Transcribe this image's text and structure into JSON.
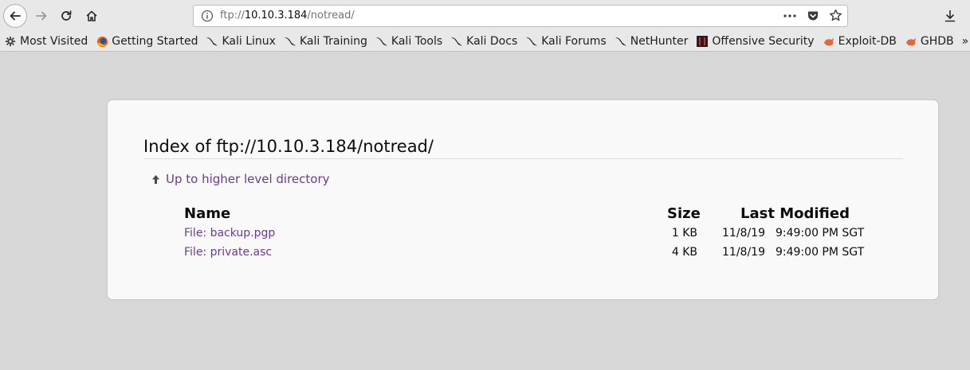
{
  "browser": {
    "url_prefix": "ftp://",
    "url_host": "10.10.3.184",
    "url_path": "/notread/"
  },
  "bookmarks": [
    {
      "label": "Most Visited",
      "icon": "gear-icon"
    },
    {
      "label": "Getting Started",
      "icon": "firefox-icon"
    },
    {
      "label": "Kali Linux",
      "icon": "kali-dragon-icon"
    },
    {
      "label": "Kali Training",
      "icon": "kali-dragon-icon"
    },
    {
      "label": "Kali Tools",
      "icon": "kali-dragon-icon"
    },
    {
      "label": "Kali Docs",
      "icon": "kali-dragon-icon"
    },
    {
      "label": "Kali Forums",
      "icon": "kali-dragon-icon"
    },
    {
      "label": "NetHunter",
      "icon": "kali-dragon-icon"
    },
    {
      "label": "Offensive Security",
      "icon": "offsec-icon"
    },
    {
      "label": "Exploit-DB",
      "icon": "exploitdb-icon"
    },
    {
      "label": "GHDB",
      "icon": "exploitdb-icon"
    }
  ],
  "listing": {
    "title": "Index of ftp://10.10.3.184/notread/",
    "up_link": "Up to higher level directory",
    "headers": {
      "name": "Name",
      "size": "Size",
      "modified": "Last Modified"
    },
    "files": [
      {
        "name": "File: backup.pgp",
        "size": "1 KB",
        "date": "11/8/19",
        "time": "9:49:00 PM SGT"
      },
      {
        "name": "File: private.asc",
        "size": "4 KB",
        "date": "11/8/19",
        "time": "9:49:00 PM SGT"
      }
    ]
  }
}
